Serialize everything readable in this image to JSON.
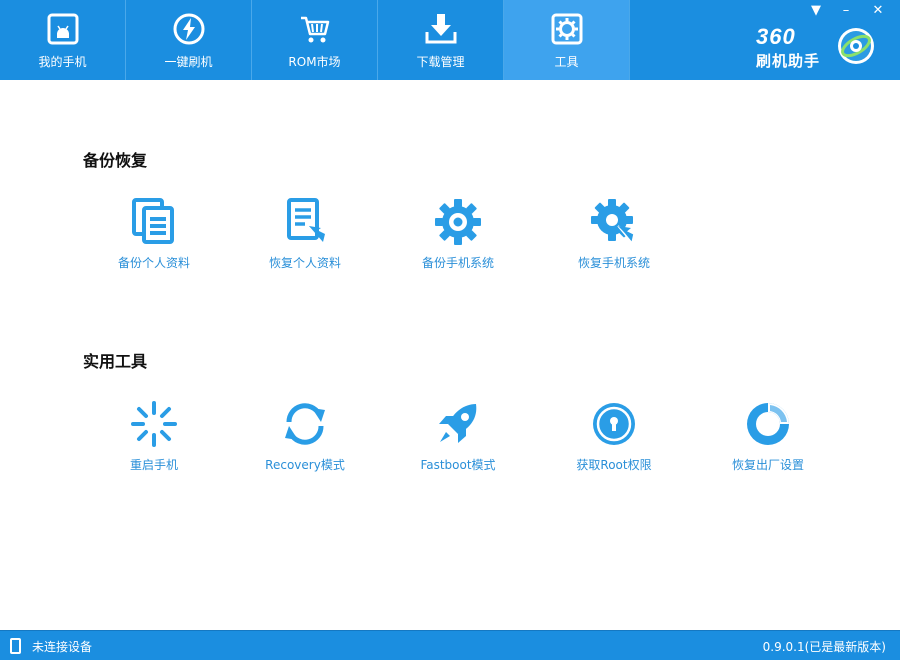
{
  "nav": {
    "tabs": [
      {
        "label": "我的手机",
        "icon": "android-phone-icon"
      },
      {
        "label": "一键刷机",
        "icon": "flash-icon"
      },
      {
        "label": "ROM市场",
        "icon": "cart-icon"
      },
      {
        "label": "下载管理",
        "icon": "download-icon"
      },
      {
        "label": "工具",
        "icon": "toolbox-icon",
        "active": true
      }
    ]
  },
  "window": {
    "menu_glyph": "▼",
    "minimize_glyph": "–",
    "close_glyph": "✕"
  },
  "logo": {
    "number": "360",
    "name": "刷机助手"
  },
  "sections": {
    "backup": {
      "title": "备份恢复",
      "items": [
        {
          "label": "备份个人资料",
          "icon": "backup-docs-icon"
        },
        {
          "label": "恢复个人资料",
          "icon": "restore-docs-icon"
        },
        {
          "label": "备份手机系统",
          "icon": "gear-icon"
        },
        {
          "label": "恢复手机系统",
          "icon": "restore-gear-icon"
        }
      ]
    },
    "tools": {
      "title": "实用工具",
      "items": [
        {
          "label": "重启手机",
          "icon": "restart-spinner-icon"
        },
        {
          "label": "Recovery模式",
          "icon": "refresh-icon"
        },
        {
          "label": "Fastboot模式",
          "icon": "rocket-icon"
        },
        {
          "label": "获取Root权限",
          "icon": "lock-icon"
        },
        {
          "label": "恢复出厂设置",
          "icon": "reset-ring-icon"
        }
      ]
    }
  },
  "status": {
    "connection": "未连接设备",
    "version": "0.9.0.1(已是最新版本)"
  },
  "colors": {
    "primary": "#1b8ee0",
    "active_tab": "#3ea3ee",
    "icon_blue": "#2a9de6",
    "label_blue": "#2a8fd8"
  }
}
